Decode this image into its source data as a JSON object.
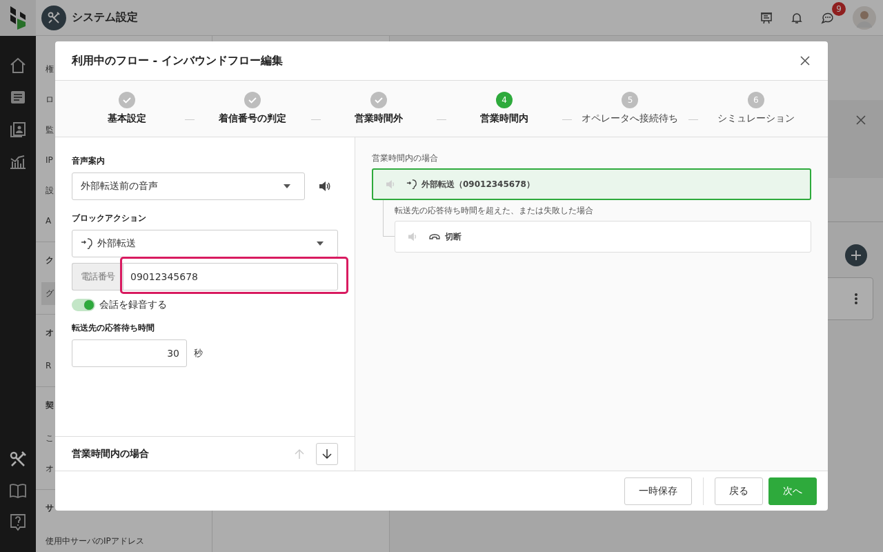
{
  "app": {
    "title": "システム設定",
    "notification_count": "9"
  },
  "sidebar": {
    "items": [
      {
        "text": "権",
        "kind": "item",
        "selected": false
      },
      {
        "text": "ロ",
        "kind": "item",
        "selected": false
      },
      {
        "text": "監",
        "kind": "item",
        "selected": false
      },
      {
        "text": "IP",
        "kind": "item",
        "selected": false
      },
      {
        "text": "設",
        "kind": "item",
        "selected": false
      },
      {
        "text": "A",
        "kind": "item",
        "selected": false
      },
      {
        "text": "ク",
        "kind": "header",
        "selected": false
      },
      {
        "text": "グ",
        "kind": "item",
        "selected": true
      },
      {
        "text": "オ",
        "kind": "header",
        "selected": false
      },
      {
        "text": "R",
        "kind": "item",
        "selected": false
      },
      {
        "text": "契",
        "kind": "header",
        "selected": false
      },
      {
        "text": "こ",
        "kind": "item",
        "selected": false
      },
      {
        "text": "オ",
        "kind": "item",
        "selected": false
      },
      {
        "text": "サ",
        "kind": "header",
        "selected": false
      },
      {
        "text": "使用中サーバのIPアドレス",
        "kind": "item",
        "selected": false
      }
    ]
  },
  "dialog": {
    "title": "利用中のフロー - インバウンドフロー編集",
    "steps": [
      {
        "label": "基本設定",
        "completed": true,
        "selected": false
      },
      {
        "label": "着信番号の判定",
        "completed": true,
        "selected": false
      },
      {
        "label": "営業時間外",
        "completed": true,
        "selected": false
      },
      {
        "number": "4",
        "label": "営業時間内",
        "completed": false,
        "selected": true
      },
      {
        "number": "5",
        "label": "オペレータへ接続待ち",
        "completed": false,
        "selected": false
      },
      {
        "number": "6",
        "label": "シミュレーション",
        "completed": false,
        "selected": false
      }
    ],
    "form": {
      "voice_label": "音声案内",
      "voice_value": "外部転送前の音声",
      "action_label": "ブロックアクション",
      "action_value": "外部転送",
      "phone": {
        "label": "電話番号",
        "value": "09012345678",
        "highlighted": true
      },
      "record": {
        "label": "会話を録音する",
        "on": true
      },
      "wait_label": "転送先の応答待ち時間",
      "wait_value": "30",
      "wait_unit": "秒"
    },
    "section": {
      "title": "営業時間内の場合",
      "move_up": {
        "disabled": true
      },
      "move_down": {
        "disabled": false
      }
    },
    "flow": {
      "label": "営業時間内の場合",
      "blocks": [
        {
          "text": "外部転送（09012345678）",
          "kind": "transfer",
          "selected": true,
          "children": [
            {
              "condition": "転送先の応答待ち時間を超えた、または失敗した場合",
              "blocks": [
                {
                  "text": "切断",
                  "kind": "hangup",
                  "selected": false
                }
              ]
            }
          ]
        }
      ]
    },
    "buttons": [
      {
        "label": "一時保存",
        "kind": "secondary"
      },
      {
        "label": "戻る",
        "kind": "secondary"
      },
      {
        "label": "次へ",
        "kind": "primary"
      }
    ]
  }
}
